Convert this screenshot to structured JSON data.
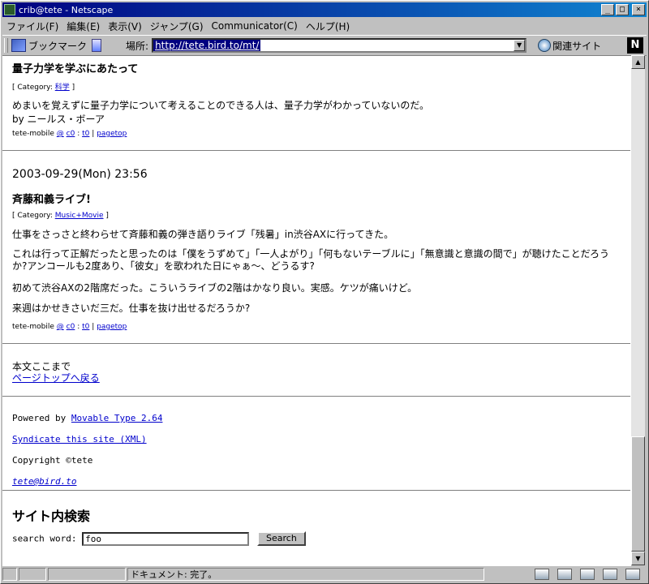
{
  "window": {
    "title": "crib@tete - Netscape"
  },
  "menu": [
    "ファイル(F)",
    "編集(E)",
    "表示(V)",
    "ジャンプ(G)",
    "Communicator(C)",
    "ヘルプ(H)"
  ],
  "location": {
    "bookmarks_label": "ブックマーク",
    "label": "場所:",
    "url": "http://tete.bird.to/mt/",
    "related_label": "関連サイト"
  },
  "post1": {
    "title": "量子力学を学ぶにあたって",
    "category_prefix": "[ Category: ",
    "category": "科学",
    "category_suffix": " ]",
    "body_line1": "めまいを覚えずに量子力学について考えることのできる人は、量子力学がわかっていないのだ。",
    "body_line2": "by ニールス・ボーア",
    "footer_author": "tete-mobile",
    "footer_at": "@",
    "footer_c": "c0",
    "footer_sep1": " : ",
    "footer_t": "t0",
    "footer_sep2": " | ",
    "footer_pagetop": "pagetop"
  },
  "post2": {
    "date": "2003-09-29(Mon) 23:56",
    "title": "斉藤和義ライブ!",
    "category_prefix": "[ Category: ",
    "category": "Music+Movie",
    "category_suffix": " ]",
    "para1": "仕事をさっさと終わらせて斉藤和義の弾き語りライブ「残暑」in渋谷AXに行ってきた。",
    "para2": "これは行って正解だったと思ったのは「僕をうずめて」「一人よがり」「何もないテーブルに」「無意識と意識の間で」が聴けたことだろうか?アンコールも2度あり、「彼女」を歌われた日にゃぁ〜、どうるす?",
    "para3": "初めて渋谷AXの2階席だった。こういうライブの2階はかなり良い。実感。ケツが痛いけど。",
    "para4": "来週はかせきさいだ三だ。仕事を抜け出せるだろうか?",
    "footer_author": "tete-mobile",
    "footer_at": "@",
    "footer_c": "c0",
    "footer_sep1": " : ",
    "footer_t": "t0",
    "footer_sep2": " | ",
    "footer_pagetop": "pagetop"
  },
  "end": {
    "text": "本文ここまで",
    "back_link": "ページトップへ戻る"
  },
  "footer": {
    "powered_prefix": "Powered by ",
    "powered_link": "Movable Type 2.64",
    "syndicate_link": "Syndicate this site (XML)",
    "copyright": "Copyright ©tete",
    "email": "tete@bird.to"
  },
  "search": {
    "heading": "サイト内検索",
    "label": "search word: ",
    "value": "foo",
    "button": "Search"
  },
  "status": {
    "text": "ドキュメント: 完了。"
  }
}
